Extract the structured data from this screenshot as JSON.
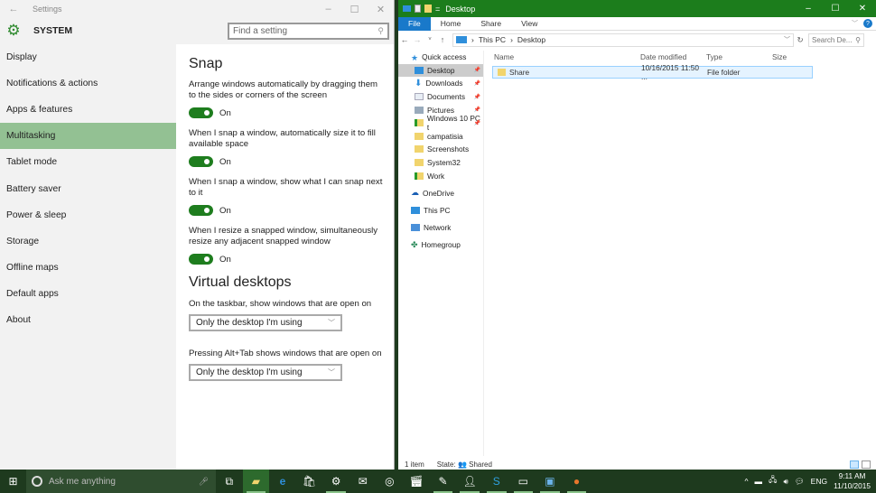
{
  "settings": {
    "window_title": "Settings",
    "section": "SYSTEM",
    "search_placeholder": "Find a setting",
    "nav": [
      "Display",
      "Notifications & actions",
      "Apps & features",
      "Multitasking",
      "Tablet mode",
      "Battery saver",
      "Power & sleep",
      "Storage",
      "Offline maps",
      "Default apps",
      "About"
    ],
    "active_nav": "Multitasking",
    "snap": {
      "heading": "Snap",
      "options": [
        {
          "label": "Arrange windows automatically by dragging them to the sides or corners of the screen",
          "state": "On"
        },
        {
          "label": "When I snap a window, automatically size it to fill available space",
          "state": "On"
        },
        {
          "label": "When I snap a window, show what I can snap next to it",
          "state": "On"
        },
        {
          "label": "When I resize a snapped window, simultaneously resize any adjacent snapped window",
          "state": "On"
        }
      ]
    },
    "virtual_desktops": {
      "heading": "Virtual desktops",
      "taskbar_label": "On the taskbar, show windows that are open on",
      "taskbar_value": "Only the desktop I'm using",
      "alttab_label": "Pressing Alt+Tab shows windows that are open on",
      "alttab_value": "Only the desktop I'm using"
    },
    "accent_color": "#1e7d1e"
  },
  "explorer": {
    "title": "Desktop",
    "ribbon_tabs": [
      "File",
      "Home",
      "Share",
      "View"
    ],
    "breadcrumb": [
      "This PC",
      "Desktop"
    ],
    "search_placeholder": "Search De...",
    "tree": {
      "quick_access": "Quick access",
      "pinned": [
        "Desktop",
        "Downloads",
        "Documents",
        "Pictures",
        "Windows 10 PC t"
      ],
      "folders": [
        "campatisia",
        "Screenshots",
        "System32",
        "Work"
      ],
      "onedrive": "OneDrive",
      "this_pc": "This PC",
      "network": "Network",
      "homegroup": "Homegroup"
    },
    "columns": [
      "Name",
      "Date modified",
      "Type",
      "Size"
    ],
    "rows": [
      {
        "name": "Share",
        "date": "10/16/2015 11:50 ...",
        "type": "File folder",
        "size": ""
      }
    ],
    "status": {
      "count": "1 item",
      "state_label": "State:",
      "state_value": "Shared"
    },
    "titlebar_color": "#1c7d1c"
  },
  "taskbar": {
    "search_placeholder": "Ask me anything",
    "tray": {
      "language": "ENG",
      "time": "9:11 AM",
      "date": "11/10/2015"
    }
  }
}
